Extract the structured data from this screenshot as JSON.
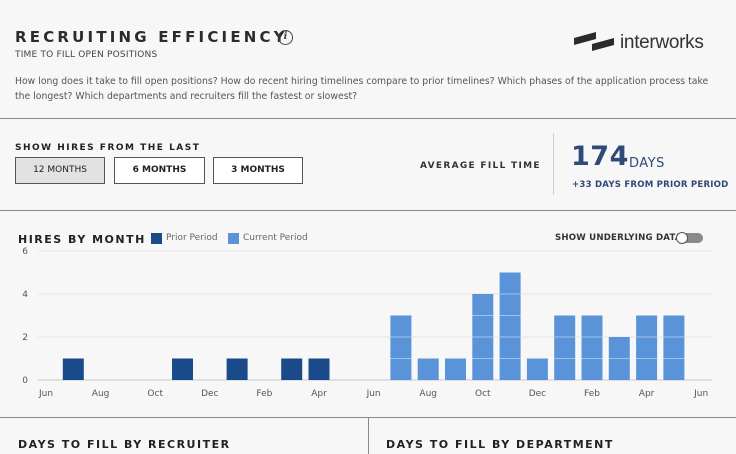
{
  "header": {
    "title": "RECRUITING EFFICIENCY",
    "subtitle": "TIME TO FILL OPEN POSITIONS",
    "description": "How long does it take to fill open positions? How do recent hiring timelines compare to prior timelines? Which phases of the application process take the longest? Which departments and recruiters fill the fastest or slowest?",
    "info_icon": "info-icon",
    "logo_text": "interworks"
  },
  "controls": {
    "label": "SHOW HIRES FROM THE LAST",
    "buttons": [
      "12 MONTHS",
      "6 MONTHS",
      "3 MONTHS"
    ],
    "selected": "12 MONTHS"
  },
  "kpi": {
    "label": "AVERAGE FILL TIME",
    "value": "174",
    "unit": "DAYS",
    "comparison": "+33 DAYS FROM PRIOR PERIOD"
  },
  "hires_chart": {
    "title": "HIRES BY MONTH",
    "legend": {
      "prior": "Prior Period",
      "current": "Current Period"
    },
    "toggle_label": "SHOW UNDERLYING DATA",
    "toggle_on": false
  },
  "chart_data": {
    "type": "bar",
    "title": "HIRES BY MONTH",
    "y_ticks": [
      0,
      2,
      4,
      6
    ],
    "ylim": [
      0,
      6
    ],
    "x_tick_labels": [
      "Jun",
      "Aug",
      "Oct",
      "Dec",
      "Feb",
      "Apr",
      "Jun",
      "Aug",
      "Oct",
      "Dec",
      "Feb",
      "Apr",
      "Jun"
    ],
    "grid": true,
    "series": [
      {
        "name": "Prior Period",
        "color": "#1a4a8a",
        "points": [
          {
            "month": "Jul",
            "value": 1
          },
          {
            "month": "Nov",
            "value": 1
          },
          {
            "month": "Jan",
            "value": 1
          },
          {
            "month": "Mar",
            "value": 1
          },
          {
            "month": "Apr",
            "value": 1
          }
        ]
      },
      {
        "name": "Current Period",
        "color": "#5b93d9",
        "points": [
          {
            "month": "Jul",
            "value": 3
          },
          {
            "month": "Aug",
            "value": 1
          },
          {
            "month": "Sep",
            "value": 1
          },
          {
            "month": "Oct",
            "value": 4
          },
          {
            "month": "Nov",
            "value": 5
          },
          {
            "month": "Dec",
            "value": 1
          },
          {
            "month": "Jan",
            "value": 3
          },
          {
            "month": "Feb",
            "value": 3
          },
          {
            "month": "Mar",
            "value": 2
          },
          {
            "month": "Apr",
            "value": 3
          },
          {
            "month": "May",
            "value": 3
          }
        ]
      }
    ]
  },
  "sections": {
    "recruiter_title": "DAYS TO FILL BY RECRUITER",
    "department_title": "DAYS TO FILL BY DEPARTMENT"
  }
}
